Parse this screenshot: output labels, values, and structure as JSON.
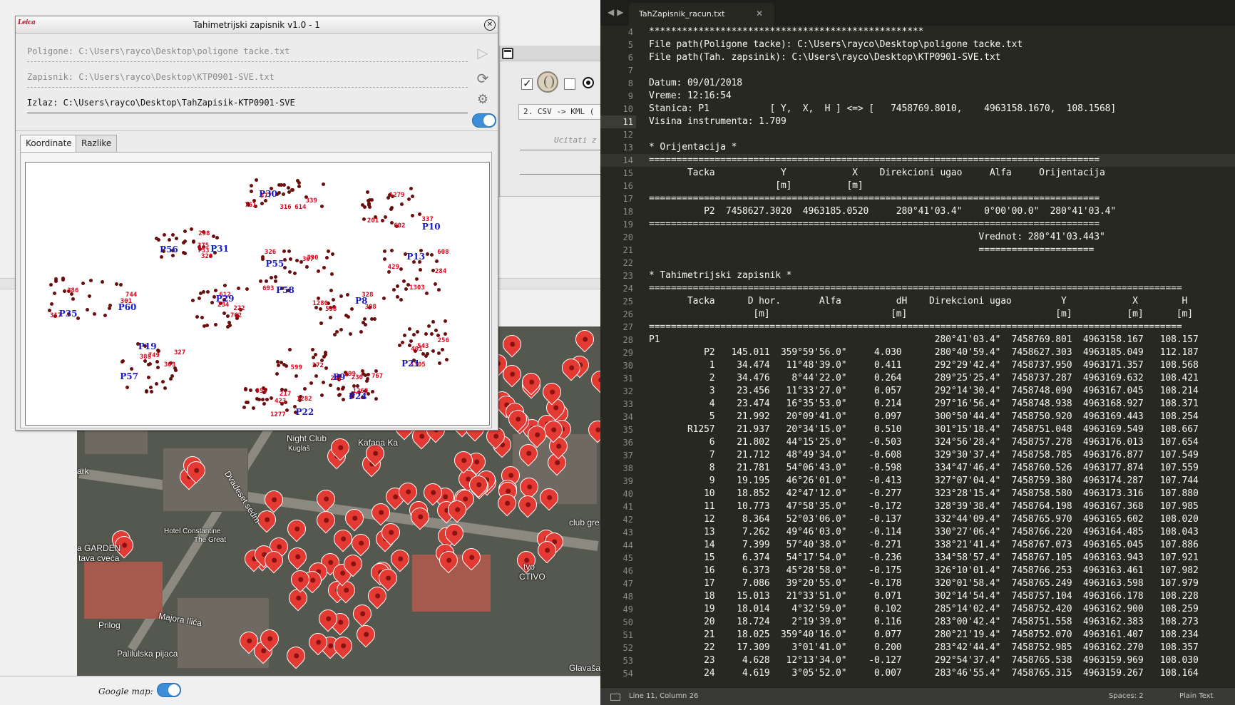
{
  "back_app": {
    "google_map_label": "Google map:",
    "converter": {
      "combo_value": "2. CSV -> KML (",
      "load_label": "Ucitati z"
    },
    "map_labels": {
      "night_club": "Night Club",
      "kuglas": "Kuglaš",
      "kafana": "Kafana Ka",
      "park": "ark",
      "street1": "Dvadeset sedm",
      "hotel": "Hotel Constantine",
      "hotel2": "The Great",
      "garden": "a GARDEN",
      "garden2": "tava cveća",
      "prilog": "Prilog",
      "majora": "Majora Ilića",
      "pijaca": "Palilulska pijaca",
      "club": "club gre",
      "tvo": "tvo",
      "actvo": "CTIVO",
      "glavasa": "Glavaša"
    }
  },
  "tah_window": {
    "title": "Tahimetrijski zapisnik v1.0 - 1",
    "logo": "Leica",
    "poligone": "Poligone: C:\\Users\\rayco\\Desktop\\poligone tacke.txt",
    "zapisnik": "Zapisnik: C:\\Users\\rayco\\Desktop\\KTP0901-SVE.txt",
    "izlaz": "Izlaz: C:\\Users\\rayco\\Desktop\\TahZapisik-KTP0901-SVE",
    "tabs": [
      "Koordinate",
      "Razlike"
    ],
    "plot_labels": [
      {
        "t": "339",
        "c": "r"
      },
      {
        "t": "298",
        "c": "r"
      },
      {
        "t": "301",
        "c": "r"
      },
      {
        "t": "303",
        "c": "r"
      },
      {
        "t": "307",
        "c": "r"
      },
      {
        "t": "308",
        "c": "r"
      },
      {
        "t": "242",
        "c": "r"
      },
      {
        "t": "201",
        "c": "r"
      },
      {
        "t": "284",
        "c": "r"
      },
      {
        "t": "256",
        "c": "r"
      },
      {
        "t": "217",
        "c": "r"
      },
      {
        "t": "230",
        "c": "r"
      },
      {
        "t": "234",
        "c": "r"
      },
      {
        "t": "316",
        "c": "r"
      },
      {
        "t": "320",
        "c": "r"
      },
      {
        "t": "317",
        "c": "r"
      },
      {
        "t": "327",
        "c": "r"
      },
      {
        "t": "326",
        "c": "r"
      },
      {
        "t": "328",
        "c": "r"
      },
      {
        "t": "272",
        "c": "r"
      },
      {
        "t": "337",
        "c": "r"
      },
      {
        "t": "429",
        "c": "r"
      },
      {
        "t": "401",
        "c": "r"
      },
      {
        "t": "423",
        "c": "r"
      },
      {
        "t": "399",
        "c": "r"
      },
      {
        "t": "222",
        "c": "r"
      },
      {
        "t": "377",
        "c": "r"
      },
      {
        "t": "375",
        "c": "r"
      },
      {
        "t": "386",
        "c": "r"
      },
      {
        "t": "388",
        "c": "r"
      },
      {
        "t": "390",
        "c": "r"
      },
      {
        "t": "1280",
        "c": "r"
      },
      {
        "t": "1282",
        "c": "r"
      },
      {
        "t": "1279",
        "c": "r"
      },
      {
        "t": "1303",
        "c": "r"
      },
      {
        "t": "1305",
        "c": "r"
      },
      {
        "t": "1277",
        "c": "r"
      },
      {
        "t": "767",
        "c": "r"
      },
      {
        "t": "762",
        "c": "r"
      },
      {
        "t": "761",
        "c": "r"
      },
      {
        "t": "753",
        "c": "r"
      },
      {
        "t": "744",
        "c": "r"
      },
      {
        "t": "749",
        "c": "r"
      },
      {
        "t": "693",
        "c": "r"
      },
      {
        "t": "598",
        "c": "r"
      },
      {
        "t": "599",
        "c": "r"
      },
      {
        "t": "602",
        "c": "r"
      },
      {
        "t": "608",
        "c": "r"
      },
      {
        "t": "543",
        "c": "r"
      },
      {
        "t": "553",
        "c": "r"
      },
      {
        "t": "1269",
        "c": "r"
      },
      {
        "t": "612",
        "c": "r"
      },
      {
        "t": "614",
        "c": "r"
      },
      {
        "t": "P56",
        "c": "b"
      },
      {
        "t": "P60",
        "c": "b"
      },
      {
        "t": "P57",
        "c": "b"
      },
      {
        "t": "P55",
        "c": "b"
      },
      {
        "t": "P8",
        "c": "b"
      },
      {
        "t": "P9",
        "c": "b"
      },
      {
        "t": "P10",
        "c": "b"
      },
      {
        "t": "P13",
        "c": "b"
      },
      {
        "t": "P21",
        "c": "b"
      },
      {
        "t": "P22",
        "c": "b"
      },
      {
        "t": "P24",
        "c": "b"
      },
      {
        "t": "P29",
        "c": "b"
      },
      {
        "t": "P30",
        "c": "b"
      },
      {
        "t": "P31",
        "c": "b"
      },
      {
        "t": "P35",
        "c": "b"
      },
      {
        "t": "P19",
        "c": "b"
      },
      {
        "t": "P58",
        "c": "b"
      }
    ]
  },
  "editor": {
    "tab_name": "TahZapisnik_racun.txt",
    "status_left": "Line 11, Column 26",
    "status_spaces": "Spaces: 2",
    "status_syntax": "Plain Text",
    "lines": [
      {
        "n": "4",
        "t": "**************************************************"
      },
      {
        "n": "5",
        "t": "File path(Poligone tacke): C:\\Users\\rayco\\Desktop\\poligone tacke.txt"
      },
      {
        "n": "6",
        "t": "File path(Tah. zapsinik): C:\\Users\\rayco\\Desktop\\KTP0901-SVE.txt"
      },
      {
        "n": "7",
        "t": ""
      },
      {
        "n": "8",
        "t": "Datum: 09/01/2018"
      },
      {
        "n": "9",
        "t": "Vreme: 12:16:54"
      },
      {
        "n": "10",
        "t": "Stanica: P1           [ Y,  X,  H ] <=> [   7458769.8010,    4963158.1670,  108.1568]"
      },
      {
        "n": "11",
        "t": "Visina instrumenta: 1.709"
      },
      {
        "n": "12",
        "t": ""
      },
      {
        "n": "13",
        "t": "* Orijentacija *"
      },
      {
        "n": "14",
        "t": "=================================================================================="
      },
      {
        "n": "15",
        "t": "       Tacka            Y            X    Direkcioni ugao     Alfa     Orijentacija"
      },
      {
        "n": "16",
        "t": "                       [m]          [m]"
      },
      {
        "n": "17",
        "t": "=================================================================================="
      },
      {
        "n": "18",
        "t": "          P2  7458627.3020  4963185.0520     280°41'03.4\"    0°00'00.0\"  280°41'03.4\""
      },
      {
        "n": "19",
        "t": "=================================================================================="
      },
      {
        "n": "20",
        "t": "                                                            Vrednot: 280°41'03.443\""
      },
      {
        "n": "21",
        "t": "                                                            ====================="
      },
      {
        "n": "22",
        "t": ""
      },
      {
        "n": "23",
        "t": "* Tahimetrijski zapisnik *"
      },
      {
        "n": "24",
        "t": "================================================================================================="
      },
      {
        "n": "25",
        "t": "       Tacka      D hor.       Alfa          dH    Direkcioni ugao         Y            X        H"
      },
      {
        "n": "26",
        "t": "                   [m]                      [m]                           [m]          [m]      [m]"
      },
      {
        "n": "27",
        "t": "================================================================================================="
      },
      {
        "n": "28",
        "t": "P1                                                  280°41'03.4\"  7458769.801  4963158.167   108.157"
      },
      {
        "n": "29",
        "t": "          P2   145.011  359°59'56.0\"     4.030      280°40'59.4\"  7458627.303  4963185.049   112.187"
      },
      {
        "n": "30",
        "t": "           1    34.474   11°48'39.0\"     0.411      292°29'42.4\"  7458737.950  4963171.357   108.568"
      },
      {
        "n": "31",
        "t": "           2    34.476    8°44'22.0\"     0.264      289°25'25.4\"  7458737.287  4963169.632   108.421"
      },
      {
        "n": "32",
        "t": "           3    23.456   11°33'27.0\"     0.057      292°14'30.4\"  7458748.090  4963167.045   108.214"
      },
      {
        "n": "33",
        "t": "           4    23.474   16°35'53.0\"     0.214      297°16'56.4\"  7458748.938  4963168.927   108.371"
      },
      {
        "n": "34",
        "t": "           5    21.992   20°09'41.0\"     0.097      300°50'44.4\"  7458750.920  4963169.443   108.254"
      },
      {
        "n": "35",
        "t": "       R1257    21.937   20°34'15.0\"     0.510      301°15'18.4\"  7458751.048  4963169.549   108.667"
      },
      {
        "n": "36",
        "t": "           6    21.802   44°15'25.0\"    -0.503      324°56'28.4\"  7458757.278  4963176.013   107.654"
      },
      {
        "n": "37",
        "t": "           7    21.712   48°49'34.0\"    -0.608      329°30'37.4\"  7458758.785  4963176.877   107.549"
      },
      {
        "n": "38",
        "t": "           8    21.781   54°06'43.0\"    -0.598      334°47'46.4\"  7458760.526  4963177.874   107.559"
      },
      {
        "n": "39",
        "t": "           9    19.195   46°26'01.0\"    -0.413      327°07'04.4\"  7458759.380  4963174.287   107.744"
      },
      {
        "n": "40",
        "t": "          10    18.852   42°47'12.0\"    -0.277      323°28'15.4\"  7458758.580  4963173.316   107.880"
      },
      {
        "n": "41",
        "t": "          11    10.773   47°58'35.0\"    -0.172      328°39'38.4\"  7458764.198  4963167.368   107.985"
      },
      {
        "n": "42",
        "t": "          12     8.364   52°03'06.0\"    -0.137      332°44'09.4\"  7458765.970  4963165.602   108.020"
      },
      {
        "n": "43",
        "t": "          13     7.262   49°46'03.0\"    -0.114      330°27'06.4\"  7458766.220  4963164.485   108.043"
      },
      {
        "n": "44",
        "t": "          14     7.399   57°40'38.0\"    -0.271      338°21'41.4\"  7458767.073  4963165.045   107.886"
      },
      {
        "n": "45",
        "t": "          15     6.374   54°17'54.0\"    -0.236      334°58'57.4\"  7458767.105  4963163.943   107.921"
      },
      {
        "n": "46",
        "t": "          16     6.373   45°28'58.0\"    -0.175      326°10'01.4\"  7458766.253  4963163.461   107.982"
      },
      {
        "n": "47",
        "t": "          17     7.086   39°20'55.0\"    -0.178      320°01'58.4\"  7458765.249  4963163.598   107.979"
      },
      {
        "n": "48",
        "t": "          18    15.013   21°33'51.0\"     0.071      302°14'54.4\"  7458757.104  4963166.178   108.228"
      },
      {
        "n": "49",
        "t": "          19    18.014    4°32'59.0\"     0.102      285°14'02.4\"  7458752.420  4963162.900   108.259"
      },
      {
        "n": "50",
        "t": "          20    18.724    2°19'39.0\"     0.116      283°00'42.4\"  7458751.558  4963162.383   108.273"
      },
      {
        "n": "51",
        "t": "          21    18.025  359°40'16.0\"     0.077      280°21'19.4\"  7458752.070  4963161.407   108.234"
      },
      {
        "n": "52",
        "t": "          22    17.309    3°01'41.0\"     0.200      283°42'44.4\"  7458752.985  4963162.270   108.357"
      },
      {
        "n": "53",
        "t": "          23     4.628   12°13'34.0\"    -0.127      292°54'37.4\"  7458765.538  4963159.969   108.030"
      },
      {
        "n": "54",
        "t": "          24     4.619    3°05'52.0\"     0.007      283°46'55.4\"  7458765.315  4963159.267   108.164"
      }
    ]
  }
}
